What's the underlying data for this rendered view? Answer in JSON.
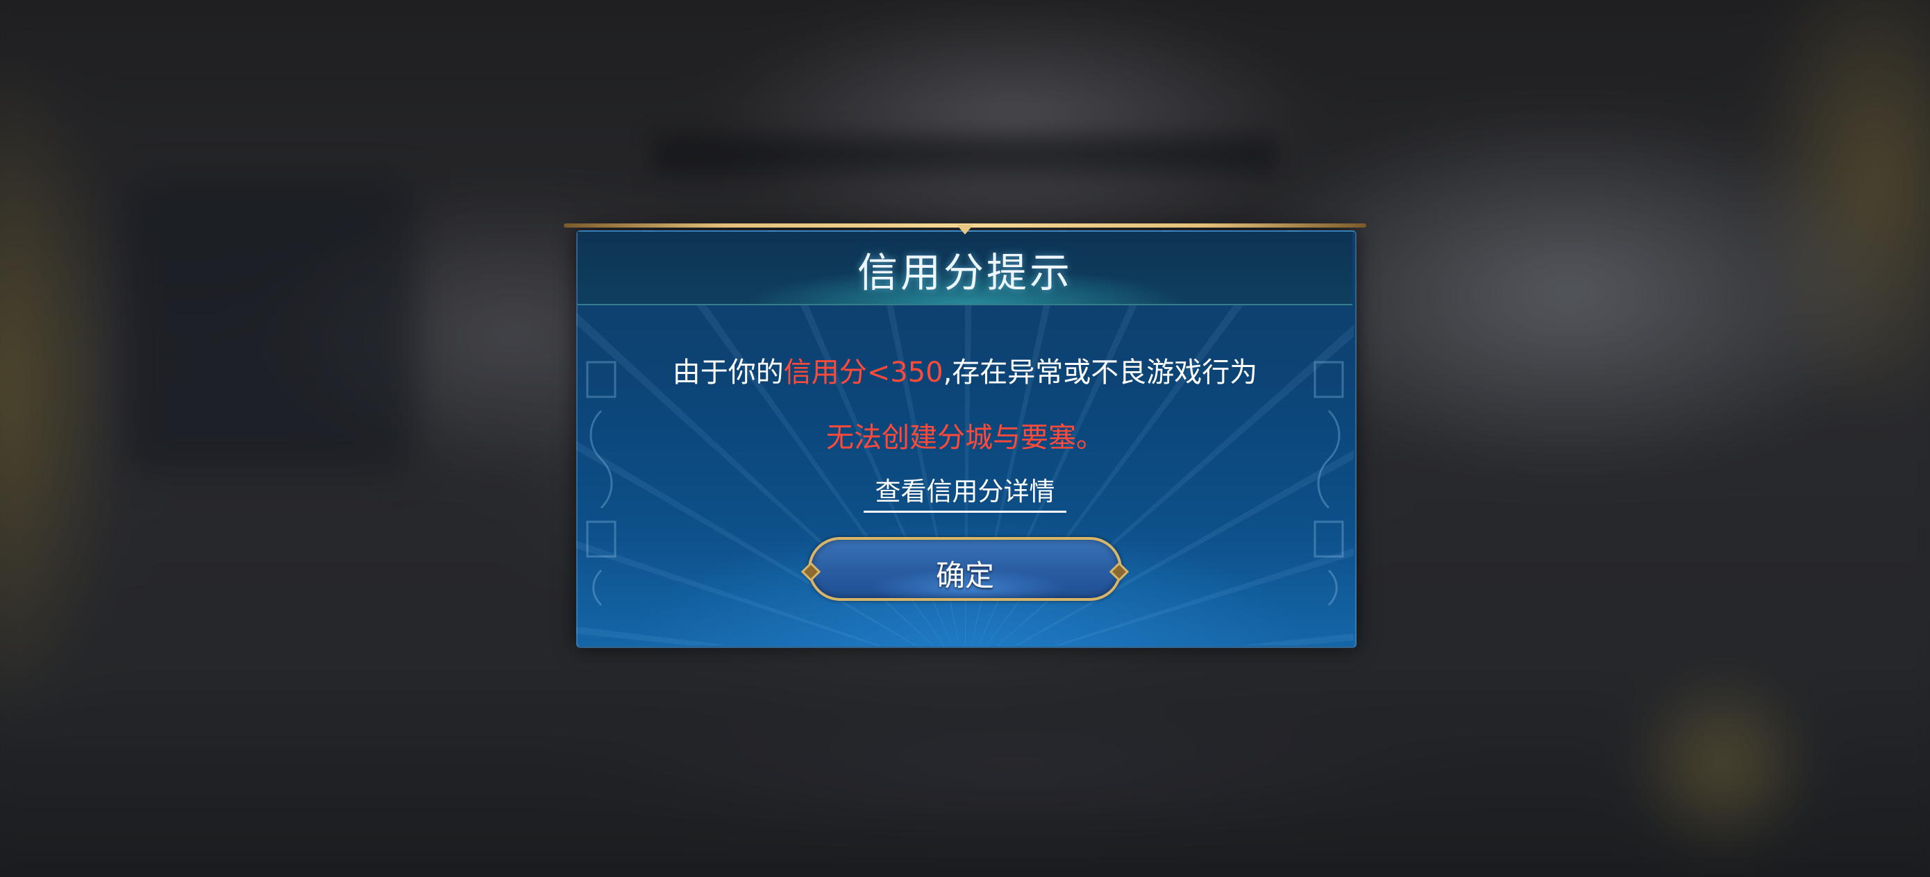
{
  "dialog": {
    "title": "信用分提示",
    "message_prefix": "由于你的",
    "message_highlight": "信用分<350",
    "message_suffix": ",存在异常或不良游戏行为",
    "message_line2": "无法创建分城与要塞。",
    "details_link": "查看信用分详情",
    "confirm_label": "确定"
  },
  "colors": {
    "highlight_red": "#ff4a3a",
    "frame_gold": "#d9b56a",
    "panel_blue": "#0c4578"
  }
}
